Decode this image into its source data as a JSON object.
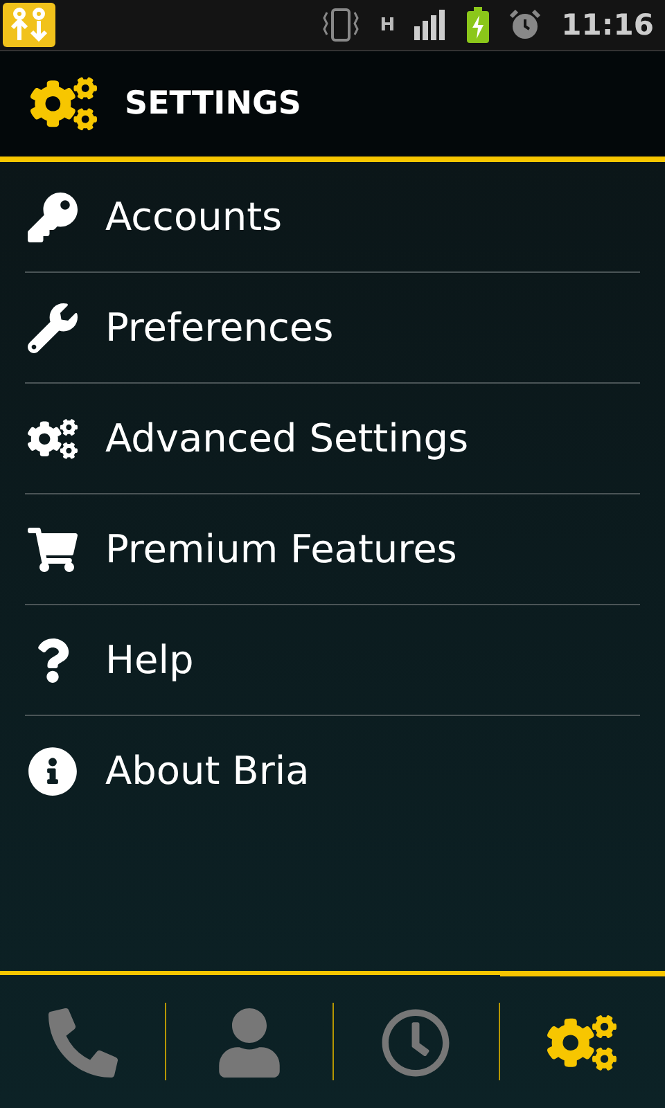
{
  "status_bar": {
    "network_type": "H",
    "time": "11:16"
  },
  "header": {
    "title": "SETTINGS"
  },
  "menu": [
    {
      "kind": "key",
      "label": "Accounts"
    },
    {
      "kind": "wrench",
      "label": "Preferences"
    },
    {
      "kind": "gears",
      "label": "Advanced Settings"
    },
    {
      "kind": "cart",
      "label": "Premium Features"
    },
    {
      "kind": "help",
      "label": "Help"
    },
    {
      "kind": "info",
      "label": "About Bria"
    }
  ],
  "bottom_tabs": [
    {
      "kind": "phone",
      "selected": false
    },
    {
      "kind": "contacts",
      "selected": false
    },
    {
      "kind": "history",
      "selected": false
    },
    {
      "kind": "settings",
      "selected": true
    }
  ]
}
